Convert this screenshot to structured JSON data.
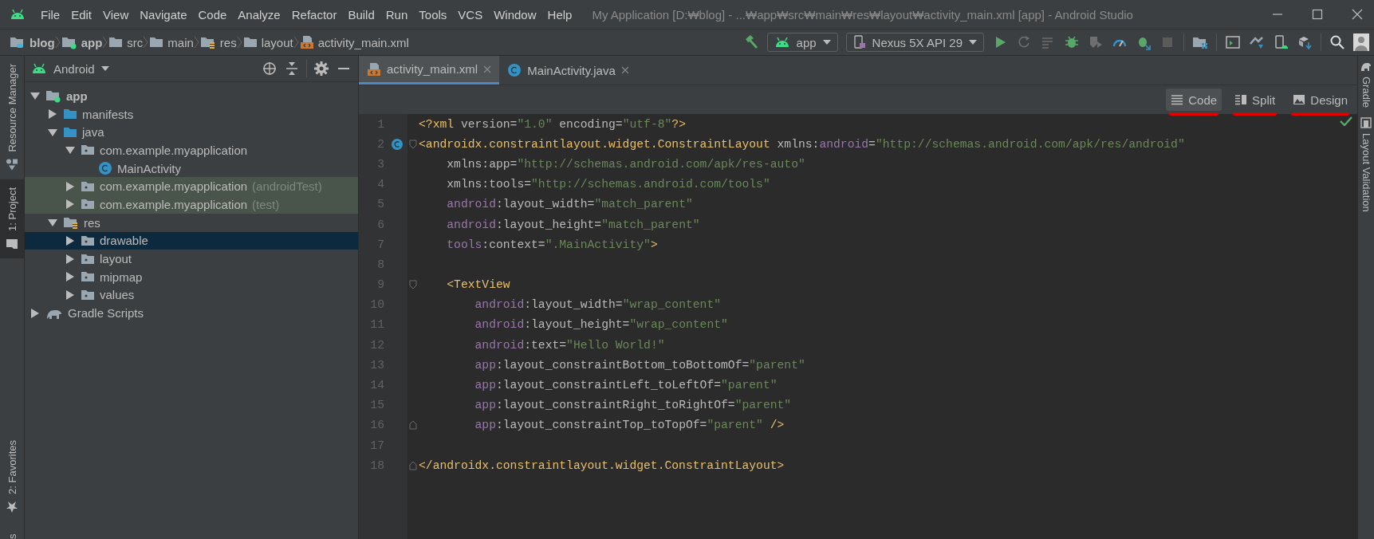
{
  "window": {
    "title": "My Application [D:₩blog] - ...₩app₩src₩main₩res₩layout₩activity_main.xml [app] - Android Studio"
  },
  "menu": [
    "File",
    "Edit",
    "View",
    "Navigate",
    "Code",
    "Analyze",
    "Refactor",
    "Build",
    "Run",
    "Tools",
    "VCS",
    "Window",
    "Help"
  ],
  "breadcrumb": [
    {
      "label": "blog",
      "kind": "project"
    },
    {
      "label": "app",
      "kind": "module"
    },
    {
      "label": "src",
      "kind": "folder"
    },
    {
      "label": "main",
      "kind": "folder"
    },
    {
      "label": "res",
      "kind": "res"
    },
    {
      "label": "layout",
      "kind": "folder"
    },
    {
      "label": "activity_main.xml",
      "kind": "layout-file"
    }
  ],
  "toolbar": {
    "configuration": "app",
    "device": "Nexus 5X API 29"
  },
  "left_strip": {
    "top": [
      {
        "label": "Resource Manager",
        "kind": "resources",
        "selected": false
      },
      {
        "label": "1: Project",
        "kind": "project",
        "selected": true
      }
    ],
    "bottom": [
      {
        "label": "2: Favorites",
        "kind": "favorites",
        "selected": false
      },
      {
        "label": "s",
        "kind": "cut",
        "selected": false
      }
    ]
  },
  "project_panel": {
    "view": "Android",
    "tree": [
      {
        "label": "app",
        "kind": "module",
        "expanded": true,
        "selected": false,
        "children": [
          {
            "label": "manifests",
            "kind": "source-folder",
            "expanded": false,
            "selected": false
          },
          {
            "label": "java",
            "kind": "source-folder",
            "expanded": true,
            "selected": false,
            "children": [
              {
                "label": "com.example.myapplication",
                "kind": "package",
                "expanded": true,
                "selected": false,
                "children": [
                  {
                    "label": "MainActivity",
                    "kind": "class",
                    "selected": false
                  }
                ]
              },
              {
                "label": "com.example.myapplication",
                "suffix": "(androidTest)",
                "highlighted": true,
                "kind": "package",
                "expanded": false,
                "selected": false
              },
              {
                "label": "com.example.myapplication",
                "suffix": "(test)",
                "highlighted": true,
                "kind": "package",
                "expanded": false,
                "selected": false
              }
            ]
          },
          {
            "label": "res",
            "kind": "res",
            "expanded": true,
            "selected": false,
            "children": [
              {
                "label": "drawable",
                "kind": "package",
                "expanded": false,
                "selected": true
              },
              {
                "label": "layout",
                "kind": "package",
                "expanded": false,
                "selected": false
              },
              {
                "label": "mipmap",
                "kind": "package",
                "expanded": false,
                "selected": false
              },
              {
                "label": "values",
                "kind": "package",
                "expanded": false,
                "selected": false
              }
            ]
          }
        ]
      },
      {
        "label": "Gradle Scripts",
        "kind": "gradle",
        "expanded": false,
        "selected": false
      }
    ]
  },
  "editor": {
    "tabs": [
      {
        "label": "activity_main.xml",
        "kind": "xml",
        "selected": true
      },
      {
        "label": "MainActivity.java",
        "kind": "java",
        "selected": false
      }
    ],
    "modes": [
      {
        "label": "Code",
        "kind": "code",
        "selected": true,
        "marked": true
      },
      {
        "label": "Split",
        "kind": "split",
        "selected": false,
        "marked": true
      },
      {
        "label": "Design",
        "kind": "design",
        "selected": false,
        "marked": true
      }
    ],
    "lines": [
      {
        "number": "1",
        "tokens": [
          {
            "kind": "tag",
            "text": "<?xml "
          },
          {
            "kind": "attr",
            "text": "version="
          },
          {
            "kind": "value",
            "text": "\"1.0\""
          },
          {
            "kind": "attr",
            "text": " encoding="
          },
          {
            "kind": "value",
            "text": "\"utf-8\""
          },
          {
            "kind": "tag",
            "text": "?>"
          }
        ]
      },
      {
        "number": "2",
        "fold_start": true,
        "class_marker": true,
        "tokens": [
          {
            "kind": "tag",
            "text": "<androidx.constraintlayout.widget.ConstraintLayout"
          },
          {
            "kind": "attr",
            "text": " xmlns:"
          },
          {
            "kind": "ns",
            "text": "android"
          },
          {
            "kind": "attr",
            "text": "="
          },
          {
            "kind": "value",
            "text": "\"http://schemas.android.com/apk/res/android\""
          }
        ]
      },
      {
        "number": "3",
        "tokens": [
          {
            "kind": "attr",
            "text": "    xmlns:app="
          },
          {
            "kind": "value",
            "text": "\"http://schemas.android.com/apk/res-auto\""
          }
        ]
      },
      {
        "number": "4",
        "tokens": [
          {
            "kind": "attr",
            "text": "    xmlns:tools="
          },
          {
            "kind": "value",
            "text": "\"http://schemas.android.com/tools\""
          }
        ]
      },
      {
        "number": "5",
        "tokens": [
          {
            "kind": "ns",
            "text": "    android"
          },
          {
            "kind": "attr",
            "text": ":layout_width="
          },
          {
            "kind": "value",
            "text": "\"match_parent\""
          }
        ]
      },
      {
        "number": "6",
        "tokens": [
          {
            "kind": "ns",
            "text": "    android"
          },
          {
            "kind": "attr",
            "text": ":layout_height="
          },
          {
            "kind": "value",
            "text": "\"match_parent\""
          }
        ]
      },
      {
        "number": "7",
        "tokens": [
          {
            "kind": "ns",
            "text": "    tools"
          },
          {
            "kind": "attr",
            "text": ":context="
          },
          {
            "kind": "value",
            "text": "\".MainActivity\""
          },
          {
            "kind": "tag",
            "text": ">"
          }
        ]
      },
      {
        "number": "8"
      },
      {
        "number": "9",
        "fold_start": true,
        "tokens": [
          {
            "kind": "tag",
            "text": "    <TextView"
          }
        ]
      },
      {
        "number": "10",
        "tokens": [
          {
            "kind": "ns",
            "text": "        android"
          },
          {
            "kind": "attr",
            "text": ":layout_width="
          },
          {
            "kind": "value",
            "text": "\"wrap_content\""
          }
        ]
      },
      {
        "number": "11",
        "tokens": [
          {
            "kind": "ns",
            "text": "        android"
          },
          {
            "kind": "attr",
            "text": ":layout_height="
          },
          {
            "kind": "value",
            "text": "\"wrap_content\""
          }
        ]
      },
      {
        "number": "12",
        "tokens": [
          {
            "kind": "ns",
            "text": "        android"
          },
          {
            "kind": "attr",
            "text": ":text="
          },
          {
            "kind": "value",
            "text": "\"Hello World!\""
          }
        ]
      },
      {
        "number": "13",
        "tokens": [
          {
            "kind": "ns",
            "text": "        app"
          },
          {
            "kind": "attr",
            "text": ":layout_constraintBottom_toBottomOf="
          },
          {
            "kind": "value",
            "text": "\"parent\""
          }
        ]
      },
      {
        "number": "14",
        "tokens": [
          {
            "kind": "ns",
            "text": "        app"
          },
          {
            "kind": "attr",
            "text": ":layout_constraintLeft_toLeftOf="
          },
          {
            "kind": "value",
            "text": "\"parent\""
          }
        ]
      },
      {
        "number": "15",
        "tokens": [
          {
            "kind": "ns",
            "text": "        app"
          },
          {
            "kind": "attr",
            "text": ":layout_constraintRight_toRightOf="
          },
          {
            "kind": "value",
            "text": "\"parent\""
          }
        ]
      },
      {
        "number": "16",
        "fold_end": true,
        "tokens": [
          {
            "kind": "ns",
            "text": "        app"
          },
          {
            "kind": "attr",
            "text": ":layout_constraintTop_toTopOf="
          },
          {
            "kind": "value",
            "text": "\"parent\""
          },
          {
            "kind": "tag",
            "text": " />"
          }
        ]
      },
      {
        "number": "17"
      },
      {
        "number": "18",
        "fold_end": true,
        "tokens": [
          {
            "kind": "tag",
            "text": "</androidx.constraintlayout.widget.ConstraintLayout>"
          }
        ]
      }
    ]
  },
  "right_strip": [
    {
      "label": "Gradle",
      "kind": "gradle"
    },
    {
      "label": "Layout Validation",
      "kind": "validation"
    }
  ]
}
